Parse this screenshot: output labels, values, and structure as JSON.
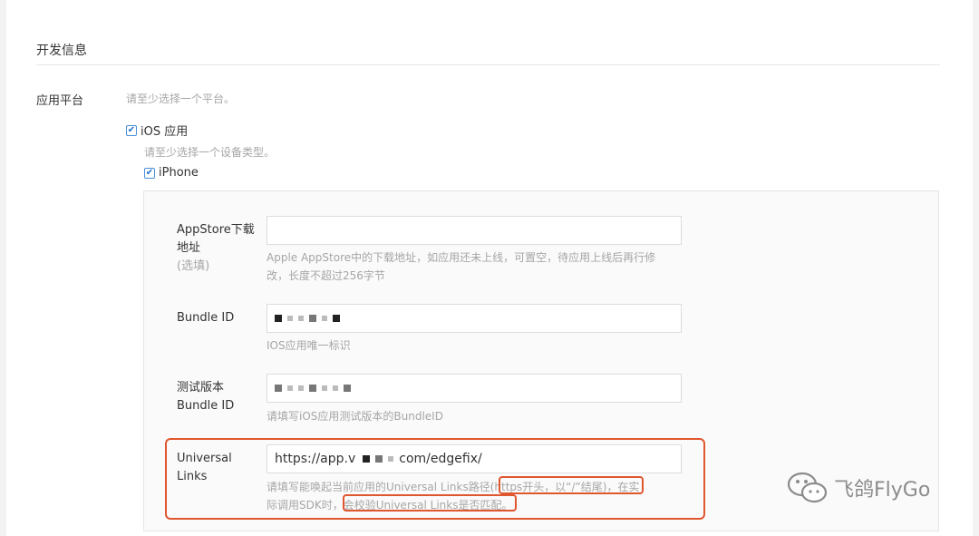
{
  "section": {
    "title": "开发信息"
  },
  "platform": {
    "label": "应用平台",
    "hint": "请至少选择一个平台。",
    "ios_checkbox_label": "iOS 应用",
    "device_hint": "请至少选择一个设备类型。",
    "iphone_checkbox_label": "iPhone"
  },
  "form": {
    "appstore": {
      "label_line1": "AppStore下载",
      "label_line2": "地址",
      "optional": "(选填)",
      "value": "",
      "hint_line1": "Apple AppStore中的下载地址，如应用还未上线，可置空，待应用上线后再行修",
      "hint_line2": "改，长度不超过256字节"
    },
    "bundle_id": {
      "label": "Bundle ID",
      "hint": "IOS应用唯一标识"
    },
    "test_bundle_id": {
      "label_line1": "测试版本",
      "label_line2": "Bundle ID",
      "hint": "请填写iOS应用测试版本的BundleID"
    },
    "universal_links": {
      "label_line1": "Universal",
      "label_line2": "Links",
      "value_prefix": "https://app.v",
      "value_suffix": "com/edgefix/",
      "hint_part1": "请填写能唤起当前应用的Universal Links路径",
      "hint_highlight1": "(https开头，以“/”结尾)",
      "hint_part2": "，在实",
      "hint_part3": "际调用SDK时，",
      "hint_highlight2": "会校验Universal Links是否匹配",
      "hint_part4": "。"
    }
  },
  "watermark": {
    "text": "飞鸽FlyGo"
  },
  "colors": {
    "accent": "#4a90d9",
    "highlight": "#e0562f",
    "hint": "#a6a6a6"
  }
}
